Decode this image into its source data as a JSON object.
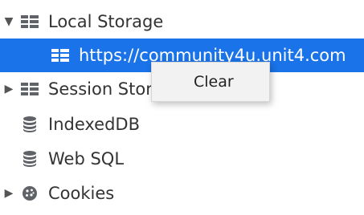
{
  "tree": {
    "items": [
      {
        "label": "Local Storage",
        "icon": "storage-grid-icon",
        "expanded": true
      },
      {
        "label": "https://community4u.unit4.com",
        "icon": "storage-grid-icon",
        "selected": true
      },
      {
        "label": "Session Storage",
        "icon": "storage-grid-icon",
        "expanded": false
      },
      {
        "label": "IndexedDB",
        "icon": "database-icon"
      },
      {
        "label": "Web SQL",
        "icon": "database-icon"
      },
      {
        "label": "Cookies",
        "icon": "cookie-icon",
        "expanded": false
      }
    ]
  },
  "context_menu": {
    "clear_label": "Clear"
  },
  "colors": {
    "selection": "#1a73e8",
    "menu_bg": "#f2f2f2"
  }
}
